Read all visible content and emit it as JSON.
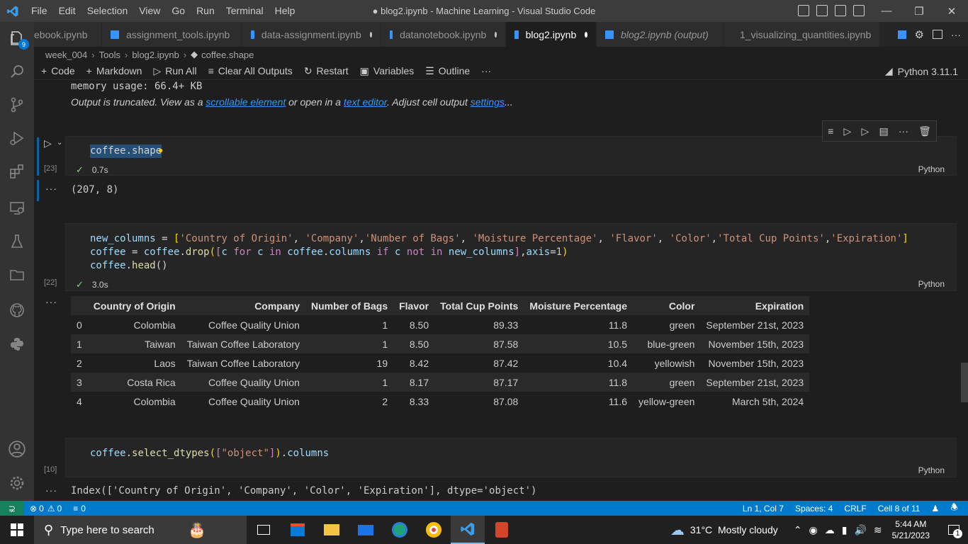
{
  "window": {
    "title": "● blog2.ipynb - Machine Learning - Visual Studio Code",
    "menu": [
      "File",
      "Edit",
      "Selection",
      "View",
      "Go",
      "Run",
      "Terminal",
      "Help"
    ]
  },
  "activity": {
    "badge": "9"
  },
  "tabs": [
    {
      "label": "ebook.ipynb",
      "modified": false,
      "active": false,
      "italic": false
    },
    {
      "label": "assignment_tools.ipynb",
      "modified": false,
      "active": false,
      "italic": false
    },
    {
      "label": "data-assignment.ipynb",
      "modified": true,
      "active": false,
      "italic": false
    },
    {
      "label": "datanotebook.ipynb",
      "modified": true,
      "active": false,
      "italic": false
    },
    {
      "label": "blog2.ipynb",
      "modified": true,
      "active": true,
      "italic": false
    },
    {
      "label": "blog2.ipynb (output)",
      "modified": false,
      "active": false,
      "italic": true
    },
    {
      "label": "1_visualizing_quantities.ipynb",
      "modified": true,
      "active": false,
      "italic": false
    }
  ],
  "breadcrumb": [
    "week_004",
    "Tools",
    "blog2.ipynb",
    "coffee.shape"
  ],
  "toolbar": {
    "code": "Code",
    "markdown": "Markdown",
    "run_all": "Run All",
    "clear_outputs": "Clear All Outputs",
    "restart": "Restart",
    "variables": "Variables",
    "outline": "Outline",
    "more": "···",
    "kernel": "Python 3.11.1"
  },
  "notebook": {
    "memory_line": "memory usage: 66.4+ KB",
    "truncated": {
      "prefix": "Output is truncated. View as a ",
      "link1": "scrollable element",
      "middle": " or open in a ",
      "link2": "text editor",
      "middle2": ". Adjust cell output ",
      "link3": "settings",
      "suffix": "..."
    },
    "cell1": {
      "code": "coffee.shape",
      "exec": "[23]",
      "time": "0.7s",
      "lang": "Python",
      "output": "(207, 8)"
    },
    "cell2": {
      "exec": "[22]",
      "time": "3.0s",
      "lang": "Python"
    },
    "cell3": {
      "code": "coffee.select_dtypes([\"object\"]).columns",
      "exec": "[10]",
      "lang": "Python",
      "output": "Index(['Country of Origin', 'Company', 'Color', 'Expiration'], dtype='object')"
    },
    "ellipsis": "···"
  },
  "dataframe": {
    "columns": [
      "",
      "Country of Origin",
      "Company",
      "Number of Bags",
      "Flavor",
      "Total Cup Points",
      "Moisture Percentage",
      "Color",
      "Expiration"
    ],
    "rows": [
      [
        "0",
        "Colombia",
        "Coffee Quality Union",
        "1",
        "8.50",
        "89.33",
        "11.8",
        "green",
        "September 21st, 2023"
      ],
      [
        "1",
        "Taiwan",
        "Taiwan Coffee Laboratory",
        "1",
        "8.50",
        "87.58",
        "10.5",
        "blue-green",
        "November 15th, 2023"
      ],
      [
        "2",
        "Laos",
        "Taiwan Coffee Laboratory",
        "19",
        "8.42",
        "87.42",
        "10.4",
        "yellowish",
        "November 15th, 2023"
      ],
      [
        "3",
        "Costa Rica",
        "Coffee Quality Union",
        "1",
        "8.17",
        "87.17",
        "11.8",
        "green",
        "September 21st, 2023"
      ],
      [
        "4",
        "Colombia",
        "Coffee Quality Union",
        "2",
        "8.33",
        "87.08",
        "11.6",
        "yellow-green",
        "March 5th, 2024"
      ]
    ]
  },
  "statusbar": {
    "errors": "0",
    "warnings": "0",
    "info": "0",
    "position": "Ln 1, Col 7",
    "spaces": "Spaces: 4",
    "eol": "CRLF",
    "cell": "Cell 8 of 11"
  },
  "taskbar": {
    "search_placeholder": "Type here to search",
    "weather": "31°C  Mostly cloudy",
    "time": "5:44 AM",
    "date": "5/21/2023",
    "notifications": "1"
  }
}
